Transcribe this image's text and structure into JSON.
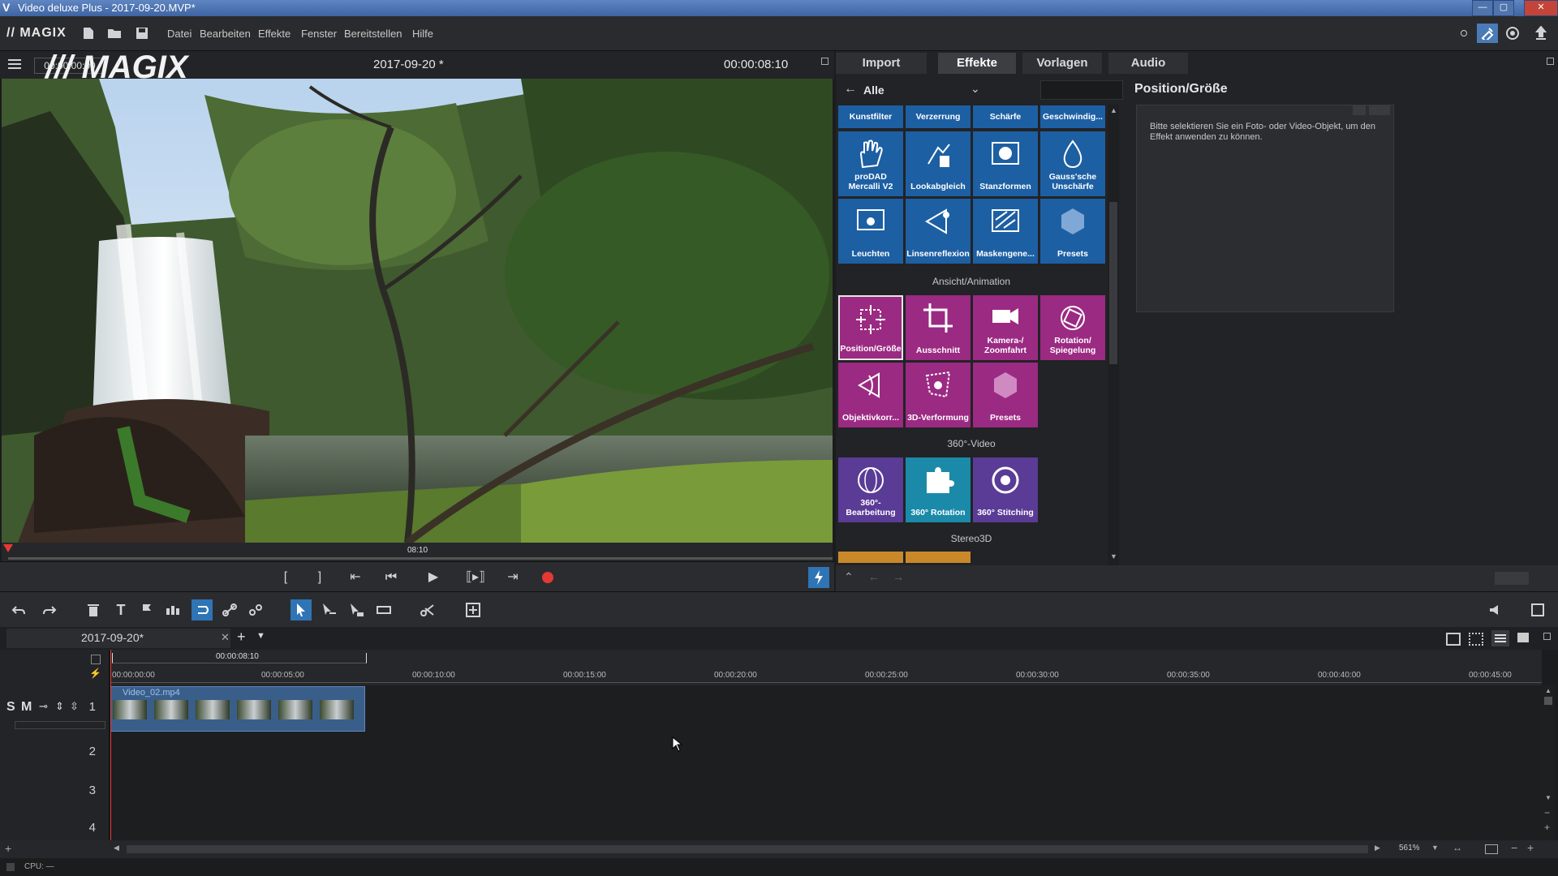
{
  "window": {
    "title": "Video deluxe Plus - 2017-09-20.MVP*",
    "logo_letter": "V"
  },
  "menubar": {
    "brand": "// MAGIX",
    "items": [
      "Datei",
      "Bearbeiten",
      "Effekte",
      "Fenster",
      "Bereitstellen",
      "Hilfe"
    ]
  },
  "preview": {
    "timecode_left": "00:00:00:00",
    "title": "2017-09-20 *",
    "timecode_right": "00:00:08:10",
    "watermark": "/// MAGIX",
    "scrub_label": "08:10"
  },
  "right_panel": {
    "tabs": [
      "Import",
      "Effekte",
      "Vorlagen",
      "Audio"
    ],
    "active_tab": "Effekte",
    "category": "Alle",
    "header_buttons": [
      "Kunstfilter",
      "Verzerrung",
      "Schärfe",
      "Geschwindig..."
    ],
    "row1": [
      "proDAD Mercalli V2",
      "Lookabgleich",
      "Stanzformen",
      "Gauss'sche Unschärfe"
    ],
    "row2": [
      "Leuchten",
      "Linsenreflexion",
      "Maskengene...",
      "Presets"
    ],
    "section_view": "Ansicht/Animation",
    "row3": [
      "Position/Größe",
      "Ausschnitt",
      "Kamera-/ Zoomfahrt",
      "Rotation/ Spiegelung"
    ],
    "row4": [
      "Objektivkorr...",
      "3D-Verformung",
      "Presets"
    ],
    "section_360": "360°-Video",
    "row5": [
      "360°- Bearbeitung",
      "360° Rotation",
      "360° Stitching"
    ],
    "section_stereo": "Stereo3D",
    "detail_title": "Position/Größe",
    "detail_hint": "Bitte selektieren Sie ein Foto- oder Video-Objekt, um den Effekt anwenden zu können."
  },
  "timeline": {
    "tab_label": "2017-09-20*",
    "marker_time": "00:00:08:10",
    "ruler": [
      "00:00:00:00",
      "00:00:05:00",
      "00:00:10:00",
      "00:00:15:00",
      "00:00:20:00",
      "00:00:25:00",
      "00:00:30:00",
      "00:00:35:00",
      "00:00:40:00",
      "00:00:45:00"
    ],
    "tracks": [
      "1",
      "2",
      "3",
      "4"
    ],
    "track_buttons": {
      "solo": "S",
      "mute": "M"
    },
    "clip_name": "Video_02.mp4",
    "zoom": "561%"
  },
  "status": {
    "cpu": "CPU: —"
  },
  "colors": {
    "accent_blue": "#1d5fa3",
    "accent_magenta": "#9b2a82",
    "record_red": "#e53935",
    "title_bar": "#3e64a3"
  }
}
